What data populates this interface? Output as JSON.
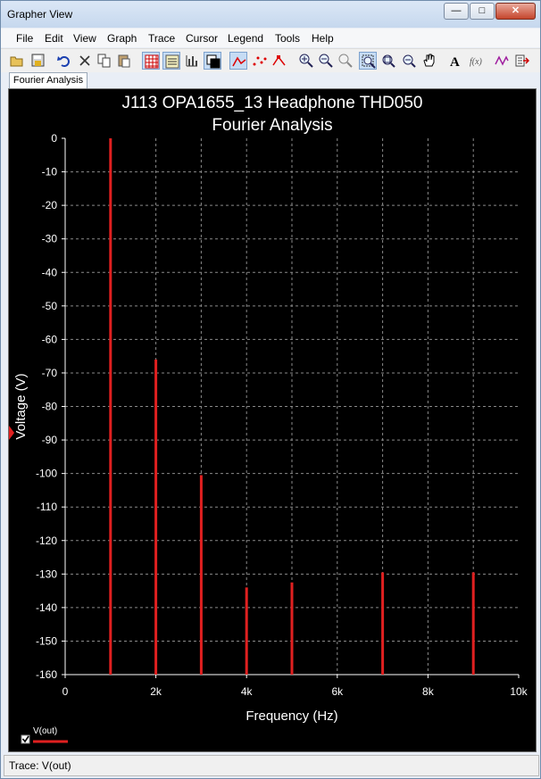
{
  "window": {
    "title": "Grapher View"
  },
  "menu": [
    "File",
    "Edit",
    "View",
    "Graph",
    "Trace",
    "Cursor",
    "Legend",
    "Tools",
    "Help"
  ],
  "toolbar_icons": [
    "open-icon",
    "save-icon",
    "undo-icon",
    "delete-icon",
    "copy-icon",
    "paste-icon",
    "grid-icon",
    "table-icon",
    "bar-chart-icon",
    "window-icon",
    "line-trace-icon",
    "points-trace-icon",
    "markers-trace-icon",
    "zoom-in-icon",
    "zoom-out-icon",
    "zoom-reset-icon",
    "zoom-box-icon",
    "zoom-fit-icon",
    "zoom-window-icon",
    "pan-hand-icon",
    "text-icon",
    "formula-icon",
    "trace-style-icon",
    "export-icon"
  ],
  "tab": {
    "label": "Fourier Analysis"
  },
  "status": {
    "text": "Trace: V(out)"
  },
  "chart_data": {
    "type": "bar",
    "title": "J113 OPA1655_13 Headphone THD050",
    "subtitle": "Fourier Analysis",
    "xlabel": "Frequency (Hz)",
    "ylabel": "Voltage (V)",
    "xlim": [
      0,
      10000
    ],
    "ylim": [
      -160,
      0
    ],
    "xticks": [
      0,
      2000,
      4000,
      6000,
      8000,
      10000
    ],
    "xtick_labels": [
      "0",
      "2k",
      "4k",
      "6k",
      "8k",
      "10k"
    ],
    "yticks": [
      0,
      -10,
      -20,
      -30,
      -40,
      -50,
      -60,
      -70,
      -80,
      -90,
      -100,
      -110,
      -120,
      -130,
      -140,
      -150,
      -160
    ],
    "ytick_labels": [
      "0",
      "-10",
      "-20",
      "-30",
      "-40",
      "-50",
      "-60",
      "-70",
      "-80",
      "-90",
      "-100",
      "-110",
      "-120",
      "-130",
      "-140",
      "-150",
      "-160"
    ],
    "grid": true,
    "legend_position": "bottom-left",
    "series": [
      {
        "name": "V(out)",
        "color": "#e02020",
        "x": [
          1000,
          2000,
          3000,
          4000,
          5000,
          7000,
          9000
        ],
        "values": [
          1,
          -66,
          -100.5,
          -134,
          -132.5,
          -129.5,
          -129.5
        ]
      }
    ]
  }
}
